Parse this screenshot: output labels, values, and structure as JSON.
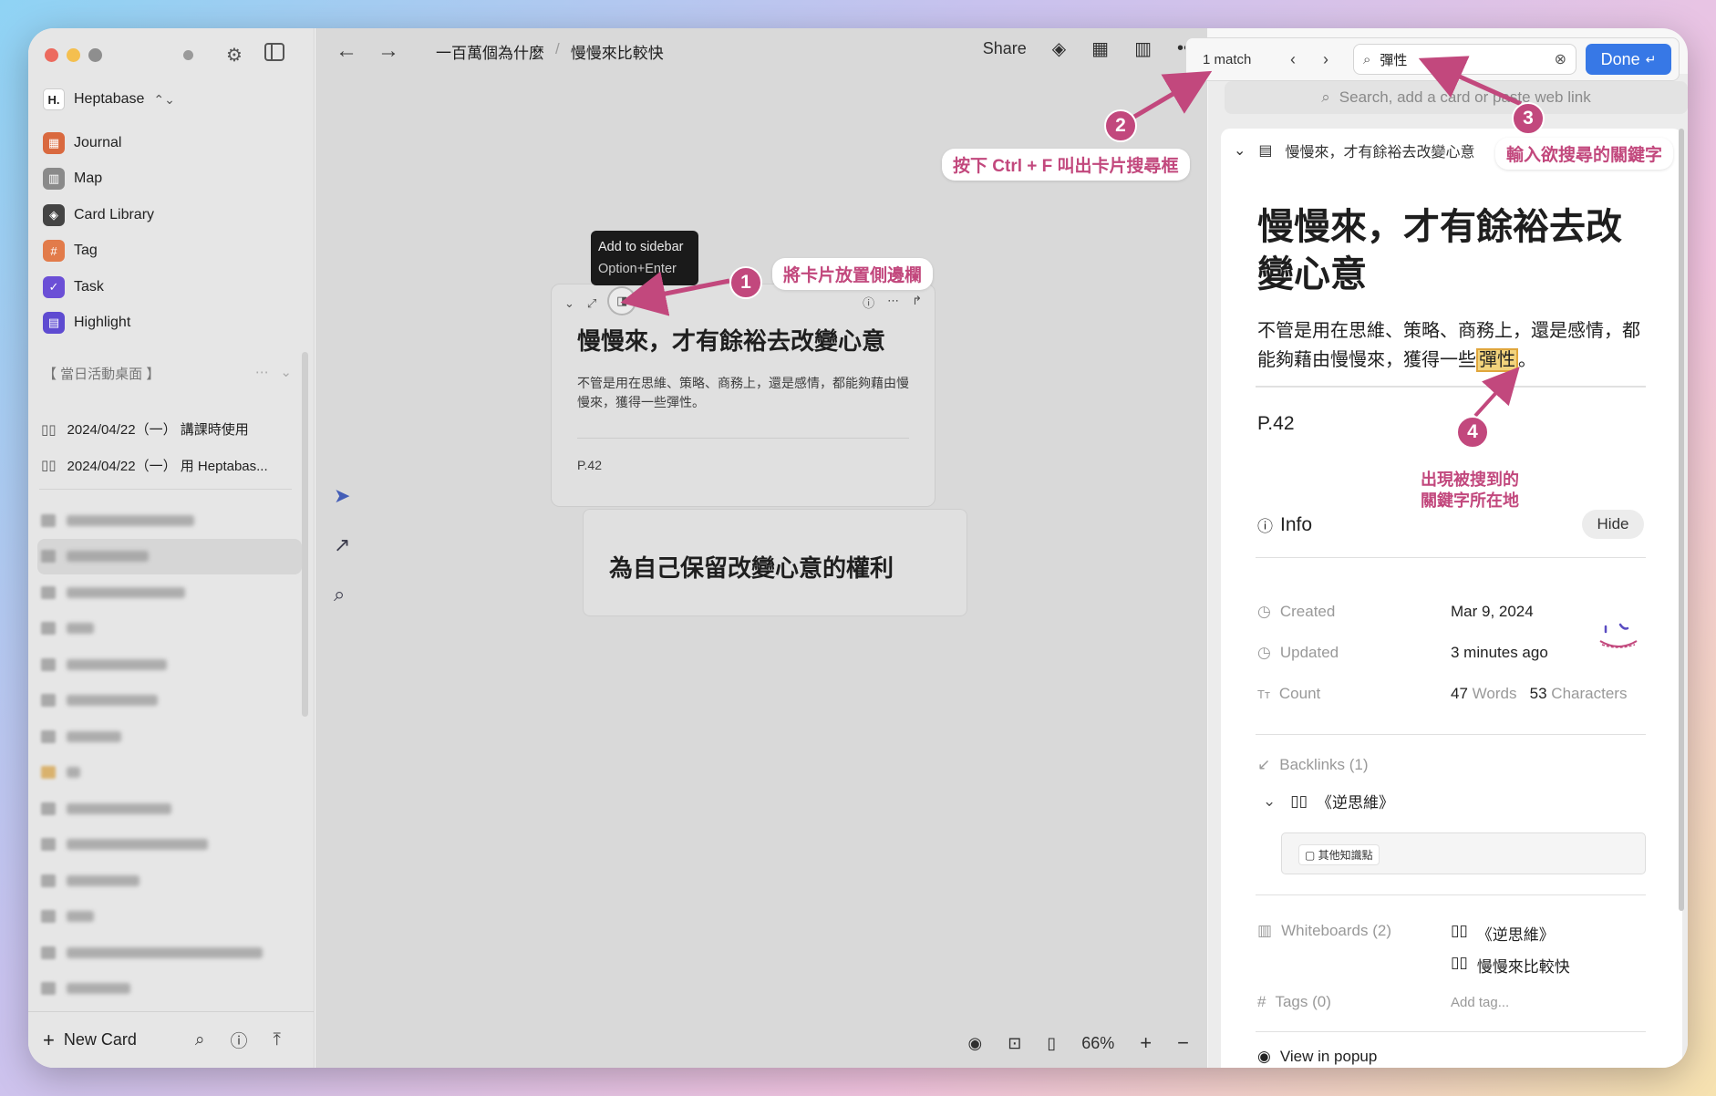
{
  "sidebar": {
    "workspace": "Heptabase",
    "workspace_logo": "H.",
    "nav": [
      {
        "label": "Journal",
        "icon": "calendar-icon",
        "color": "#d9693f"
      },
      {
        "label": "Map",
        "icon": "map-icon",
        "color": "#8a8a8a"
      },
      {
        "label": "Card Library",
        "icon": "layers-icon",
        "color": "#444444"
      },
      {
        "label": "Tag",
        "icon": "hash-icon",
        "color": "#e27b4a"
      },
      {
        "label": "Task",
        "icon": "check-icon",
        "color": "#6b4fd6"
      },
      {
        "label": "Highlight",
        "icon": "highlight-icon",
        "color": "#5e4bd1"
      }
    ],
    "section_title": "【 當日活動桌面 】",
    "dash_items": [
      "2024/04/22（一） 講課時使用",
      "2024/04/22（一） 用 Heptabas..."
    ],
    "new_card": "New Card"
  },
  "topbar": {
    "breadcrumb_root": "一百萬個為什麼",
    "breadcrumb_current": "慢慢來比較快",
    "share": "Share"
  },
  "canvas": {
    "tooltip_title": "Add to sidebar",
    "tooltip_shortcut": "Option+Enter",
    "card1_title": "慢慢來，才有餘裕去改變心意",
    "card1_body": "不管是用在思維、策略、商務上，還是感情，都能夠藉由慢慢來，獲得一些彈性。",
    "card1_page": "P.42",
    "card2_title": "為自己保留改變心意的權利",
    "zoom": "66%"
  },
  "find": {
    "count": "1 match",
    "query": "彈性",
    "done": "Done"
  },
  "right_panel": {
    "search_placeholder": "Search, add a card or paste web link",
    "card_header": "慢慢來，才有餘裕去改變心意",
    "title": "慢慢來，才有餘裕去改變心意",
    "body_before": "不管是用在思維、策略、商務上，還是感情，都能夠藉由慢慢來，獲得一些",
    "body_highlight": "彈性",
    "body_after": "。",
    "page": "P.42",
    "info": "Info",
    "hide": "Hide",
    "created_label": "Created",
    "created_value": "Mar 9, 2024",
    "updated_label": "Updated",
    "updated_value": "3 minutes ago",
    "count_label": "Count",
    "words_num": "47",
    "words_label": "Words",
    "chars_num": "53",
    "chars_label": "Characters",
    "backlinks": "Backlinks (1)",
    "backlink_title": "《逆思維》",
    "backlink_chip": "其他知識點",
    "whiteboards": "Whiteboards (2)",
    "whiteboard_items": [
      "《逆思維》",
      "慢慢來比較快"
    ],
    "tags": "Tags (0)",
    "add_tag": "Add tag...",
    "view_popup": "View in popup"
  },
  "annotations": {
    "a1_num": "1",
    "a1_text": "將卡片放置側邊欄",
    "a2_num": "2",
    "a2_text": "按下 Ctrl + F 叫出卡片搜尋框",
    "a3_num": "3",
    "a3_text": "輸入欲搜尋的關鍵字",
    "a4_num": "4",
    "a4_line1": "出現被搜到的",
    "a4_line2": "關鍵字所在地",
    "accent": "#c2487d"
  }
}
